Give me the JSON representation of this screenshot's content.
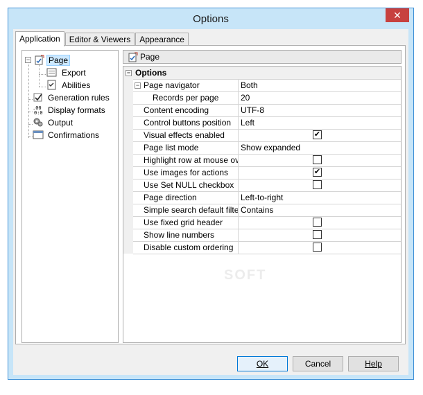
{
  "window": {
    "title": "Options",
    "close_glyph": "✕"
  },
  "tabs": [
    {
      "label": "Application",
      "active": true
    },
    {
      "label": "Editor & Viewers",
      "active": false
    },
    {
      "label": "Appearance",
      "active": false
    }
  ],
  "tree": {
    "items": [
      {
        "label": "Page",
        "icon": "page-edit-icon",
        "selected": true
      },
      {
        "label": "Export",
        "icon": "export-icon"
      },
      {
        "label": "Abilities",
        "icon": "abilities-icon"
      },
      {
        "label": "Generation rules",
        "icon": "rules-icon"
      },
      {
        "label": "Display formats",
        "icon": "formats-icon"
      },
      {
        "label": "Output",
        "icon": "output-icon"
      },
      {
        "label": "Confirmations",
        "icon": "confirmations-icon"
      }
    ]
  },
  "panel": {
    "header": "Page",
    "group": "Options",
    "properties": [
      {
        "name": "Page navigator",
        "value": "Both",
        "type": "text",
        "expander": true
      },
      {
        "name": "Records per page",
        "value": "20",
        "type": "text",
        "sub": true
      },
      {
        "name": "Content encoding",
        "value": "UTF-8",
        "type": "text"
      },
      {
        "name": "Control buttons position",
        "value": "Left",
        "type": "text"
      },
      {
        "name": "Visual effects enabled",
        "value": true,
        "type": "check"
      },
      {
        "name": "Page list mode",
        "value": "Show expanded",
        "type": "text"
      },
      {
        "name": "Highlight row at mouse over",
        "value": false,
        "type": "check"
      },
      {
        "name": "Use images for actions",
        "value": true,
        "type": "check"
      },
      {
        "name": "Use Set NULL checkbox",
        "value": false,
        "type": "check"
      },
      {
        "name": "Page direction",
        "value": "Left-to-right",
        "type": "text"
      },
      {
        "name": "Simple search default filter",
        "value": "Contains",
        "type": "text"
      },
      {
        "name": "Use fixed grid header",
        "value": false,
        "type": "check"
      },
      {
        "name": "Show line numbers",
        "value": false,
        "type": "check"
      },
      {
        "name": "Disable custom ordering",
        "value": false,
        "type": "check"
      }
    ]
  },
  "buttons": {
    "ok": "OK",
    "cancel": "Cancel",
    "help": "Help"
  },
  "watermark": "SOFT",
  "colors": {
    "window_border": "#3c8fd6",
    "frame": "#c7e5f8",
    "close": "#c7413f",
    "selection": "#cce8ff"
  }
}
